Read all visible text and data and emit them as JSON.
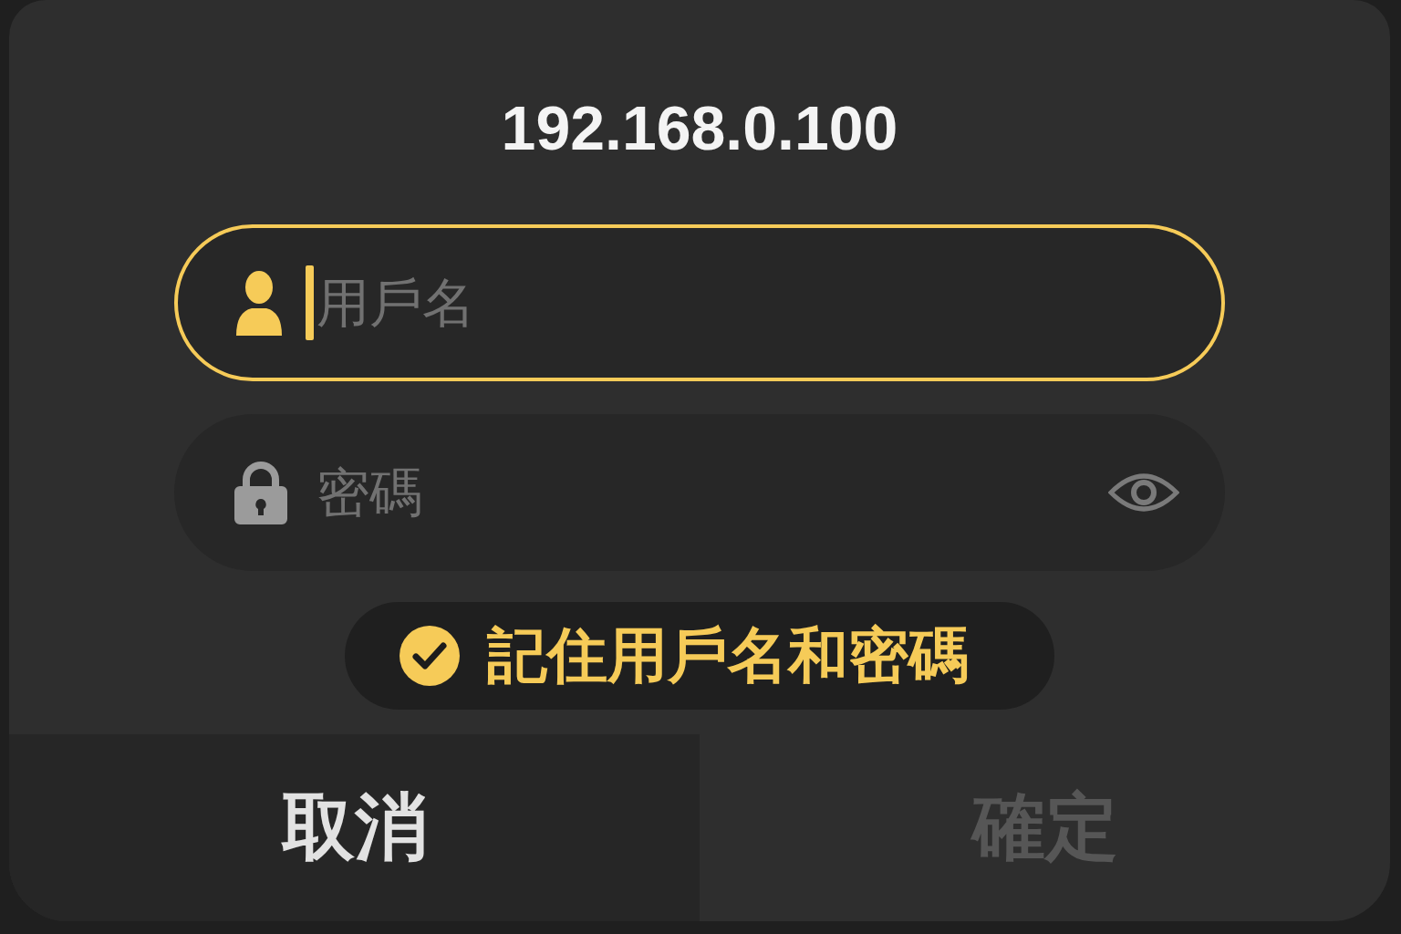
{
  "dialog": {
    "title": "192.168.0.100"
  },
  "fields": [
    {
      "kind": "username",
      "placeholder": "用戶名",
      "focused": true
    },
    {
      "kind": "password",
      "placeholder": "密碼",
      "focused": false
    }
  ],
  "remember": {
    "label": "記住用戶名和密碼",
    "checked": true
  },
  "buttons": [
    {
      "label": "取消",
      "disabled": false
    },
    {
      "label": "確定",
      "disabled": true
    }
  ]
}
